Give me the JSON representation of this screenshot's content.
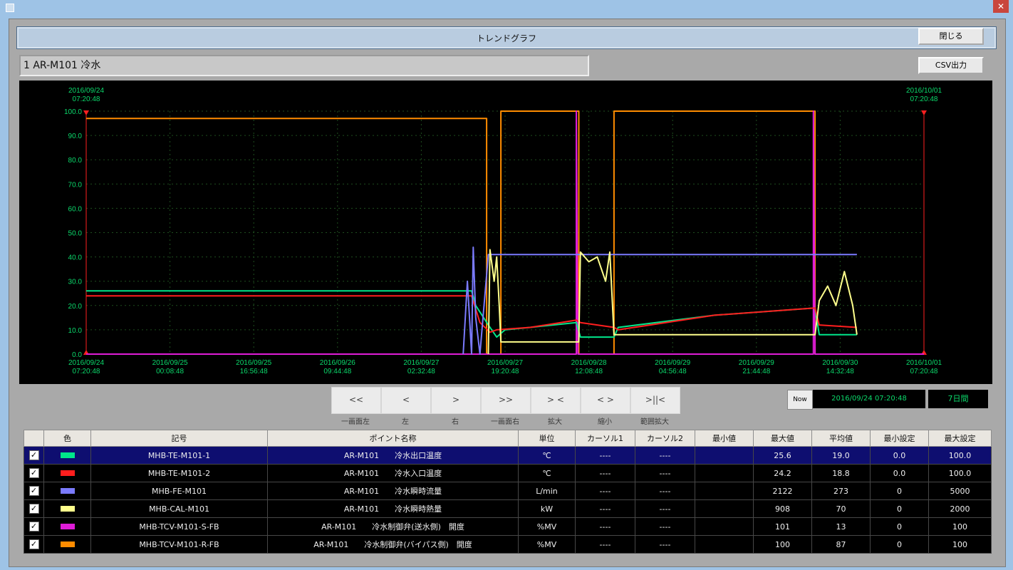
{
  "window": {
    "title": "トレンドグラフ",
    "close_label": "閉じる",
    "csv_label": "CSV出力"
  },
  "point": {
    "label": "1 AR-M101 冷水"
  },
  "chart_data": {
    "type": "line",
    "ylim": [
      0,
      100
    ],
    "y_ticks": [
      "100.0",
      "90.0",
      "80.0",
      "70.0",
      "60.0",
      "50.0",
      "40.0",
      "30.0",
      "20.0",
      "10.0",
      "0.0"
    ],
    "x_ticks": [
      {
        "date": "2016/09/24",
        "time": "07:20:48"
      },
      {
        "date": "2016/09/25",
        "time": "00:08:48"
      },
      {
        "date": "2016/09/25",
        "time": "16:56:48"
      },
      {
        "date": "2016/09/26",
        "time": "09:44:48"
      },
      {
        "date": "2016/09/27",
        "time": "02:32:48"
      },
      {
        "date": "2016/09/27",
        "time": "19:20:48"
      },
      {
        "date": "2016/09/28",
        "time": "12:08:48"
      },
      {
        "date": "2016/09/29",
        "time": "04:56:48"
      },
      {
        "date": "2016/09/29",
        "time": "21:44:48"
      },
      {
        "date": "2016/09/30",
        "time": "14:32:48"
      },
      {
        "date": "2016/10/01",
        "time": "07:20:48"
      }
    ],
    "cursor_left": {
      "date": "2016/09/24",
      "time": "07:20:48"
    },
    "cursor_right": {
      "date": "2016/10/01",
      "time": "07:20:48"
    },
    "series": [
      {
        "color": "#ff8c00",
        "points": [
          [
            0,
            97
          ],
          [
            4.78,
            97
          ],
          [
            4.78,
            0
          ],
          [
            4.95,
            0
          ],
          [
            4.95,
            100
          ],
          [
            5.88,
            100
          ],
          [
            5.88,
            0
          ],
          [
            6.3,
            0
          ],
          [
            6.3,
            100
          ],
          [
            8.7,
            100
          ],
          [
            8.7,
            0
          ],
          [
            10,
            0
          ]
        ]
      },
      {
        "color": "#e01cd8",
        "points": [
          [
            0,
            0
          ],
          [
            4.78,
            0
          ],
          [
            4.78,
            0
          ],
          [
            5.85,
            0
          ],
          [
            5.85,
            100
          ],
          [
            5.87,
            0
          ],
          [
            8.68,
            0
          ],
          [
            8.68,
            100
          ],
          [
            8.7,
            0
          ],
          [
            10,
            0
          ]
        ]
      },
      {
        "color": "#00e68a",
        "points": [
          [
            0,
            26
          ],
          [
            4.6,
            26
          ],
          [
            4.65,
            20
          ],
          [
            4.8,
            12
          ],
          [
            4.9,
            7
          ],
          [
            5.0,
            10
          ],
          [
            5.3,
            11
          ],
          [
            5.85,
            13
          ],
          [
            5.9,
            7
          ],
          [
            6.3,
            7
          ],
          [
            6.35,
            11
          ],
          [
            7.5,
            16
          ],
          [
            8.7,
            19
          ],
          [
            8.75,
            8
          ],
          [
            9.2,
            8
          ]
        ]
      },
      {
        "color": "#ff1e1e",
        "points": [
          [
            0,
            24
          ],
          [
            4.6,
            24
          ],
          [
            4.7,
            13
          ],
          [
            4.82,
            9
          ],
          [
            4.9,
            10
          ],
          [
            5.3,
            11
          ],
          [
            5.85,
            14
          ],
          [
            5.9,
            13
          ],
          [
            6.3,
            11
          ],
          [
            6.35,
            10
          ],
          [
            7.5,
            16
          ],
          [
            8.7,
            19
          ],
          [
            8.75,
            12
          ],
          [
            9.2,
            11
          ]
        ]
      },
      {
        "color": "#7b7bff",
        "points": [
          [
            4.5,
            0
          ],
          [
            4.55,
            30
          ],
          [
            4.6,
            0
          ],
          [
            4.62,
            44
          ],
          [
            4.65,
            15
          ],
          [
            4.7,
            0
          ],
          [
            4.8,
            41
          ],
          [
            4.95,
            41
          ],
          [
            5.88,
            41
          ],
          [
            5.9,
            41
          ],
          [
            6.3,
            41
          ],
          [
            8.7,
            41
          ],
          [
            8.75,
            41
          ],
          [
            9.2,
            41
          ]
        ]
      },
      {
        "color": "#ffff8c",
        "points": [
          [
            4.8,
            0
          ],
          [
            4.82,
            43
          ],
          [
            4.87,
            30
          ],
          [
            4.9,
            40
          ],
          [
            4.93,
            20
          ],
          [
            4.95,
            5
          ],
          [
            5.88,
            5
          ],
          [
            5.9,
            42
          ],
          [
            6.0,
            38
          ],
          [
            6.1,
            40
          ],
          [
            6.2,
            30
          ],
          [
            6.25,
            42
          ],
          [
            6.3,
            8
          ],
          [
            8.7,
            8
          ],
          [
            8.75,
            22
          ],
          [
            8.85,
            28
          ],
          [
            8.95,
            20
          ],
          [
            9.05,
            34
          ],
          [
            9.15,
            20
          ],
          [
            9.2,
            8
          ]
        ]
      }
    ]
  },
  "nav": {
    "buttons": [
      {
        "icon": "<<",
        "label": "一画面左"
      },
      {
        "icon": "<",
        "label": "左"
      },
      {
        "icon": ">",
        "label": "右"
      },
      {
        "icon": ">>",
        "label": "一画面右"
      },
      {
        "icon": ">  <",
        "label": "拡大"
      },
      {
        "icon": "< >",
        "label": "縮小"
      },
      {
        "icon": ">||<",
        "label": "範囲拡大"
      }
    ],
    "now_label": "Now",
    "now_value": "2016/09/24 07:20:48",
    "range_value": "7日間"
  },
  "table": {
    "headers": [
      "",
      "色",
      "記号",
      "ポイント名称",
      "単位",
      "カーソル1",
      "カーソル2",
      "最小値",
      "最大値",
      "平均値",
      "最小設定",
      "最大設定"
    ],
    "rows": [
      {
        "checked": "✓",
        "color": "#00e68a",
        "code": "MHB-TE-M101-1",
        "name": "AR-M101　　冷水出口温度",
        "unit": "℃",
        "c1": "----",
        "c2": "----",
        "min": "",
        "max": "25.6",
        "avg": "19.0",
        "min_set": "0.0",
        "max_set": "100.0"
      },
      {
        "checked": "✓",
        "color": "#ff1e1e",
        "code": "MHB-TE-M101-2",
        "name": "AR-M101　　冷水入口温度",
        "unit": "℃",
        "c1": "----",
        "c2": "----",
        "min": "",
        "max": "24.2",
        "avg": "18.8",
        "min_set": "0.0",
        "max_set": "100.0"
      },
      {
        "checked": "✓",
        "color": "#7b7bff",
        "code": "MHB-FE-M101",
        "name": "AR-M101　　冷水瞬時流量",
        "unit": "L/min",
        "c1": "----",
        "c2": "----",
        "min": "",
        "max": "2122",
        "avg": "273",
        "min_set": "0",
        "max_set": "5000"
      },
      {
        "checked": "✓",
        "color": "#ffff8c",
        "code": "MHB-CAL-M101",
        "name": "AR-M101　　冷水瞬時熱量",
        "unit": "kW",
        "c1": "----",
        "c2": "----",
        "min": "",
        "max": "908",
        "avg": "70",
        "min_set": "0",
        "max_set": "2000"
      },
      {
        "checked": "✓",
        "color": "#e01cd8",
        "code": "MHB-TCV-M101-S-FB",
        "name": "AR-M101　　冷水制御弁(送水側)　開度",
        "unit": "%MV",
        "c1": "----",
        "c2": "----",
        "min": "",
        "max": "101",
        "avg": "13",
        "min_set": "0",
        "max_set": "100"
      },
      {
        "checked": "✓",
        "color": "#ff8c00",
        "code": "MHB-TCV-M101-R-FB",
        "name": "AR-M101　　冷水制御弁(バイパス側)　開度",
        "unit": "%MV",
        "c1": "----",
        "c2": "----",
        "min": "",
        "max": "100",
        "avg": "87",
        "min_set": "0",
        "max_set": "100"
      }
    ]
  }
}
